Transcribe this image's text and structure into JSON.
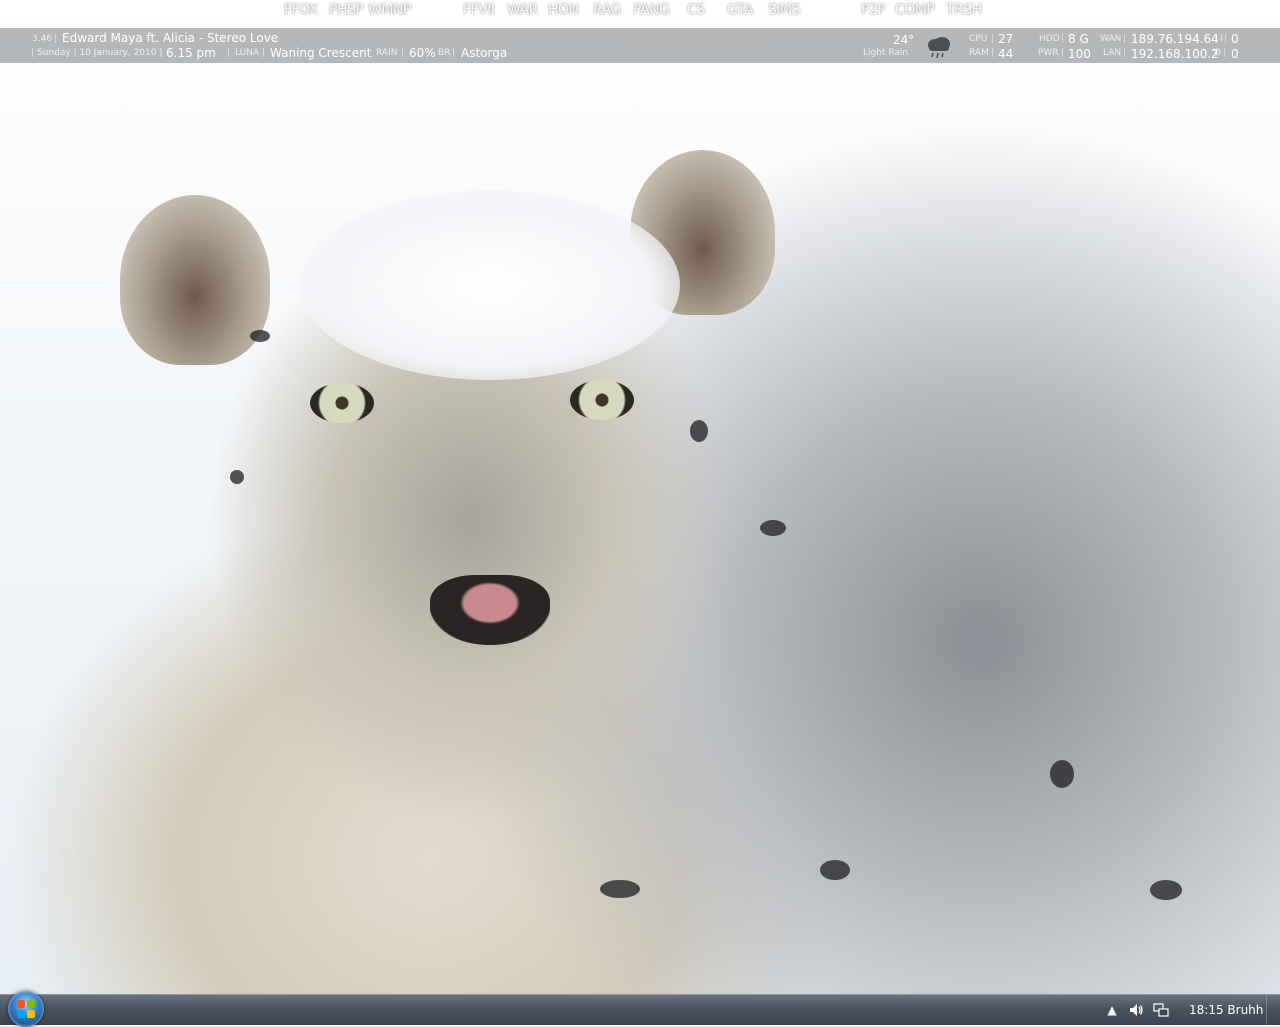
{
  "launcher": {
    "items": [
      "FFOX",
      "PHSP",
      "WMNP",
      "FFVII",
      "WAR",
      "HON",
      "RAG",
      "PANG",
      "CS",
      "GTA",
      "SIMS",
      "P2P",
      "COMP",
      "TRSH"
    ]
  },
  "music": {
    "time": "3.46",
    "track": "Edward Maya ft. Alicia - Stereo Love"
  },
  "datetime": {
    "date": "Sunday | 10 January, 2010 |",
    "time": "6.15 pm"
  },
  "moon": {
    "label": "LUNA",
    "phase": "Waning Crescent"
  },
  "rain": {
    "label": "RAIN",
    "value": "60%"
  },
  "location": {
    "label": "BR",
    "value": "Astorga"
  },
  "weather": {
    "temp": "24°",
    "condition": "Light Rain",
    "icon": "rain-cloud-icon"
  },
  "system": {
    "cpu_label": "CPU",
    "cpu_value": "27",
    "ram_label": "RAM",
    "ram_value": "44",
    "hdd_label": "HDD",
    "hdd_value": "8 G",
    "pwr_label": "PWR",
    "pwr_value": "100"
  },
  "network": {
    "wan_label": "WAN",
    "wan_value": "189.76.194.64",
    "wan_in_label": "I",
    "wan_in_value": "0",
    "lan_label": "LAN",
    "lan_value": "192.168.100.2",
    "lan_out_label": "O",
    "lan_out_value": "0"
  },
  "taskbar": {
    "clock": "18:15 Bruhh",
    "tray_icons": [
      "show-hidden-icons-icon",
      "volume-icon",
      "network-icon"
    ]
  },
  "colors": {
    "bar": "#787c80",
    "taskbar": "#4a545f"
  }
}
